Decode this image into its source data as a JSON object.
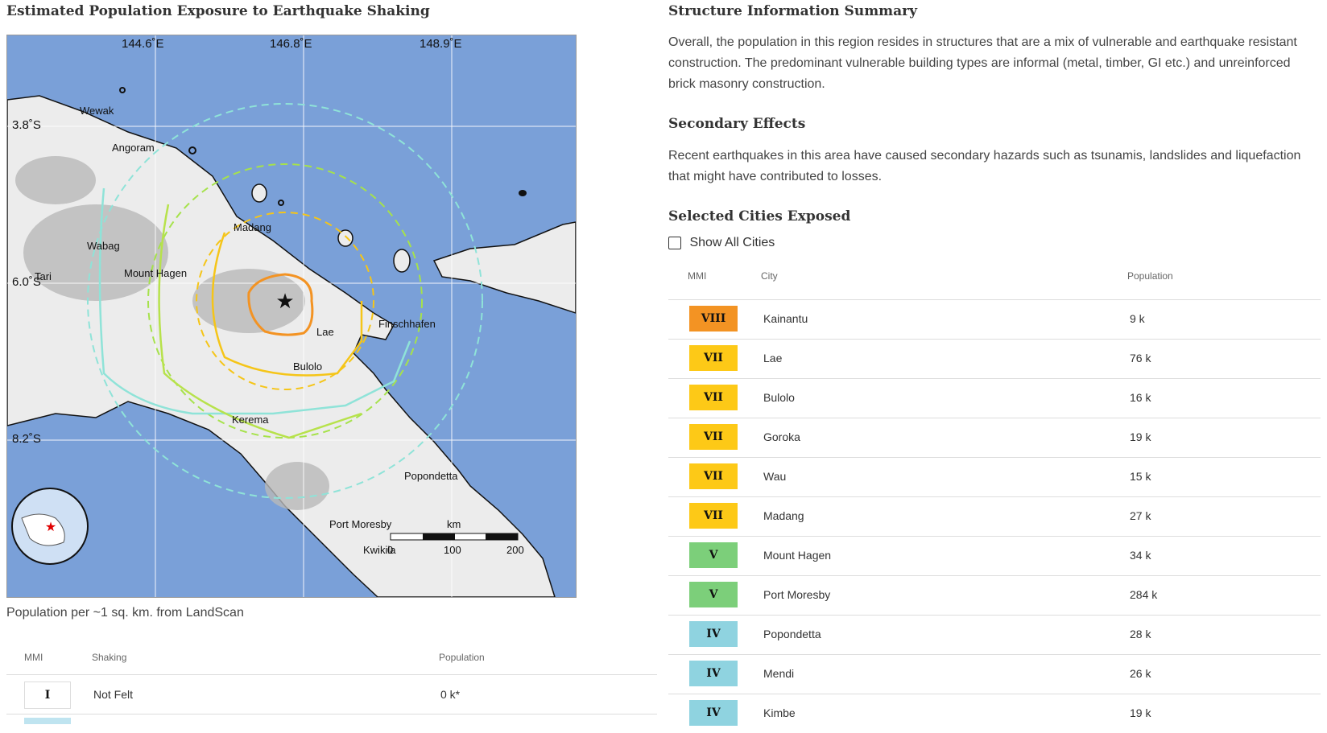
{
  "left": {
    "title": "Estimated Population Exposure to Earthquake Shaking",
    "map": {
      "lon_labels": [
        "144.6˚E",
        "146.8˚E",
        "148.9˚E"
      ],
      "lat_labels": [
        "3.8˚S",
        "6.0˚S",
        "8.2˚S"
      ],
      "cities": [
        "Wewak",
        "Angoram",
        "Madang",
        "Wabag",
        "Tari",
        "Mount Hagen",
        "Lae",
        "Finschhafen",
        "Bulolo",
        "Kerema",
        "Popondetta",
        "Port Moresby",
        "Kwikila"
      ],
      "scale_unit": "km",
      "scale_ticks": [
        "0",
        "100",
        "200"
      ]
    },
    "caption": "Population per ~1 sq. km. from LandScan",
    "table": {
      "headers": {
        "mmi": "MMI",
        "shaking": "Shaking",
        "population": "Population"
      },
      "rows": [
        {
          "mmi": "I",
          "shaking": "Not Felt",
          "population": "0 k*"
        }
      ]
    }
  },
  "right": {
    "structure": {
      "title": "Structure Information Summary",
      "text": "Overall, the population in this region resides in structures that are a mix of vulnerable and earthquake resistant construction. The predominant vulnerable building types are informal (metal, timber, GI etc.) and unreinforced brick masonry construction."
    },
    "secondary": {
      "title": "Secondary Effects",
      "text": "Recent earthquakes in this area have caused secondary hazards such as tsunamis, landslides and liquefaction that might have contributed to losses."
    },
    "cities": {
      "title": "Selected Cities Exposed",
      "show_all_label": "Show All Cities",
      "headers": {
        "mmi": "MMI",
        "city": "City",
        "population": "Population"
      },
      "rows": [
        {
          "mmi": "VIII",
          "city": "Kainantu",
          "population": "9 k",
          "color": "#f39323"
        },
        {
          "mmi": "VII",
          "city": "Lae",
          "population": "76 k",
          "color": "#fdc917"
        },
        {
          "mmi": "VII",
          "city": "Bulolo",
          "population": "16 k",
          "color": "#fdc917"
        },
        {
          "mmi": "VII",
          "city": "Goroka",
          "population": "19 k",
          "color": "#fdc917"
        },
        {
          "mmi": "VII",
          "city": "Wau",
          "population": "15 k",
          "color": "#fdc917"
        },
        {
          "mmi": "VII",
          "city": "Madang",
          "population": "27 k",
          "color": "#fdc917"
        },
        {
          "mmi": "V",
          "city": "Mount Hagen",
          "population": "34 k",
          "color": "#7ccf7a"
        },
        {
          "mmi": "V",
          "city": "Port Moresby",
          "population": "284 k",
          "color": "#7ccf7a"
        },
        {
          "mmi": "IV",
          "city": "Popondetta",
          "population": "28 k",
          "color": "#8fd3e0"
        },
        {
          "mmi": "IV",
          "city": "Mendi",
          "population": "26 k",
          "color": "#8fd3e0"
        },
        {
          "mmi": "IV",
          "city": "Kimbe",
          "population": "19 k",
          "color": "#8fd3e0"
        }
      ]
    }
  }
}
